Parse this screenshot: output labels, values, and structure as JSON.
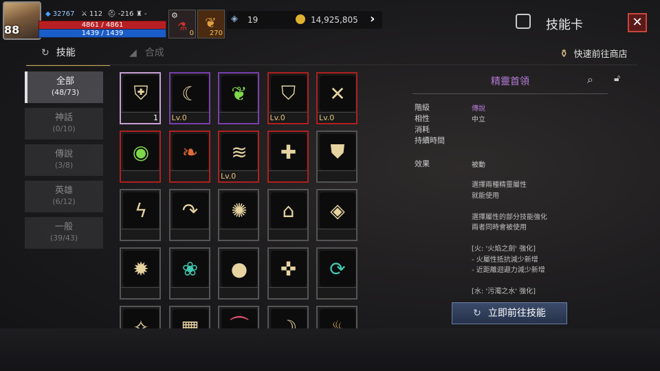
{
  "player": {
    "level": "88",
    "power": "32767",
    "stat_a": "112",
    "stat_b": "-216",
    "stat_c": "-",
    "hp": "4861 / 4861",
    "mp": "1439 / 1439"
  },
  "slots": [
    {
      "icon": "potion-icon",
      "count": "0"
    },
    {
      "icon": "feather-icon",
      "count": "270"
    }
  ],
  "currency": {
    "crystal": "19",
    "gold": "14,925,805"
  },
  "header": {
    "title": "技能卡"
  },
  "tabs": [
    {
      "label": "技能"
    },
    {
      "label": "合成"
    }
  ],
  "shop_label": "快速前往商店",
  "filters": [
    {
      "label": "全部",
      "count": "(48/73)"
    },
    {
      "label": "神話",
      "count": "(0/10)"
    },
    {
      "label": "傳說",
      "count": "(3/8)"
    },
    {
      "label": "英雄",
      "count": "(6/12)"
    },
    {
      "label": "一般",
      "count": "(39/43)"
    }
  ],
  "cards": [
    {
      "icon": "elemental-shield-icon",
      "label": "1",
      "rarity": "#c8a0d8"
    },
    {
      "icon": "moon-laurel-icon",
      "label": "Lv.0",
      "rarity": "#7a3fb0"
    },
    {
      "icon": "leaf-laurel-icon",
      "label": "",
      "rarity": "#7a3fb0"
    },
    {
      "icon": "bow-shield-icon",
      "label": "Lv.0",
      "rarity": "#b02020"
    },
    {
      "icon": "crossed-arrows-icon",
      "label": "Lv.0",
      "rarity": "#b02020"
    },
    {
      "icon": "radar-icon",
      "label": "",
      "rarity": "#b02020"
    },
    {
      "icon": "feather-wing-icon",
      "label": "",
      "rarity": "#b02020"
    },
    {
      "icon": "wing-icon",
      "label": "Lv.0",
      "rarity": "#b02020"
    },
    {
      "icon": "heal-plus-icon",
      "label": "",
      "rarity": "#b02020"
    },
    {
      "icon": "shield-icon",
      "label": "",
      "rarity": "#555555"
    },
    {
      "icon": "lightning-icon",
      "label": "",
      "rarity": "#555555"
    },
    {
      "icon": "curved-arrow-icon",
      "label": "",
      "rarity": "#555555"
    },
    {
      "icon": "burst-icon",
      "label": "",
      "rarity": "#555555"
    },
    {
      "icon": "sparkle-dome-icon",
      "label": "",
      "rarity": "#555555"
    },
    {
      "icon": "eye-icon",
      "label": "",
      "rarity": "#555555"
    },
    {
      "icon": "vortex-icon",
      "label": "",
      "rarity": "#555555"
    },
    {
      "icon": "leaf-slash-icon",
      "label": "",
      "rarity": "#555555"
    },
    {
      "icon": "orb-spring-icon",
      "label": "",
      "rarity": "#555555"
    },
    {
      "icon": "target-totem-icon",
      "label": "",
      "rarity": "#555555"
    },
    {
      "icon": "cycle-arrows-icon",
      "label": "",
      "rarity": "#555555"
    },
    {
      "icon": "sparkles-icon",
      "label": "",
      "rarity": "#555555"
    },
    {
      "icon": "blocks-icon",
      "label": "",
      "rarity": "#555555"
    },
    {
      "icon": "bat-wing-icon",
      "label": "",
      "rarity": "#555555"
    },
    {
      "icon": "crescent-orb-icon",
      "label": "",
      "rarity": "#555555"
    },
    {
      "icon": "flame-wing-icon",
      "label": "",
      "rarity": "#555555"
    }
  ],
  "detail": {
    "title": "精靈首領",
    "fields": [
      {
        "key": "階級",
        "value": "傳說"
      },
      {
        "key": "相性",
        "value": "中立"
      },
      {
        "key": "消耗",
        "value": ""
      },
      {
        "key": "持續時間",
        "value": ""
      },
      {
        "key": "效果",
        "value": "被動"
      }
    ],
    "description": [
      "選擇兩種精靈屬性",
      "就能使用",
      "",
      "選擇屬性的部分技能強化",
      "兩者同時會被使用",
      "",
      "[火: '火焰之劍' 強化]",
      "- 火屬性抵抗減少新增",
      "- 近距離迴避力減少新增",
      "",
      "[水: '污濁之水' 強化]"
    ],
    "go_button": "立即前往技能"
  },
  "colors": {
    "legend": "#b57ad8",
    "epic": "#7a3fb0",
    "rare": "#b02020",
    "gold": "#e6c37a"
  }
}
